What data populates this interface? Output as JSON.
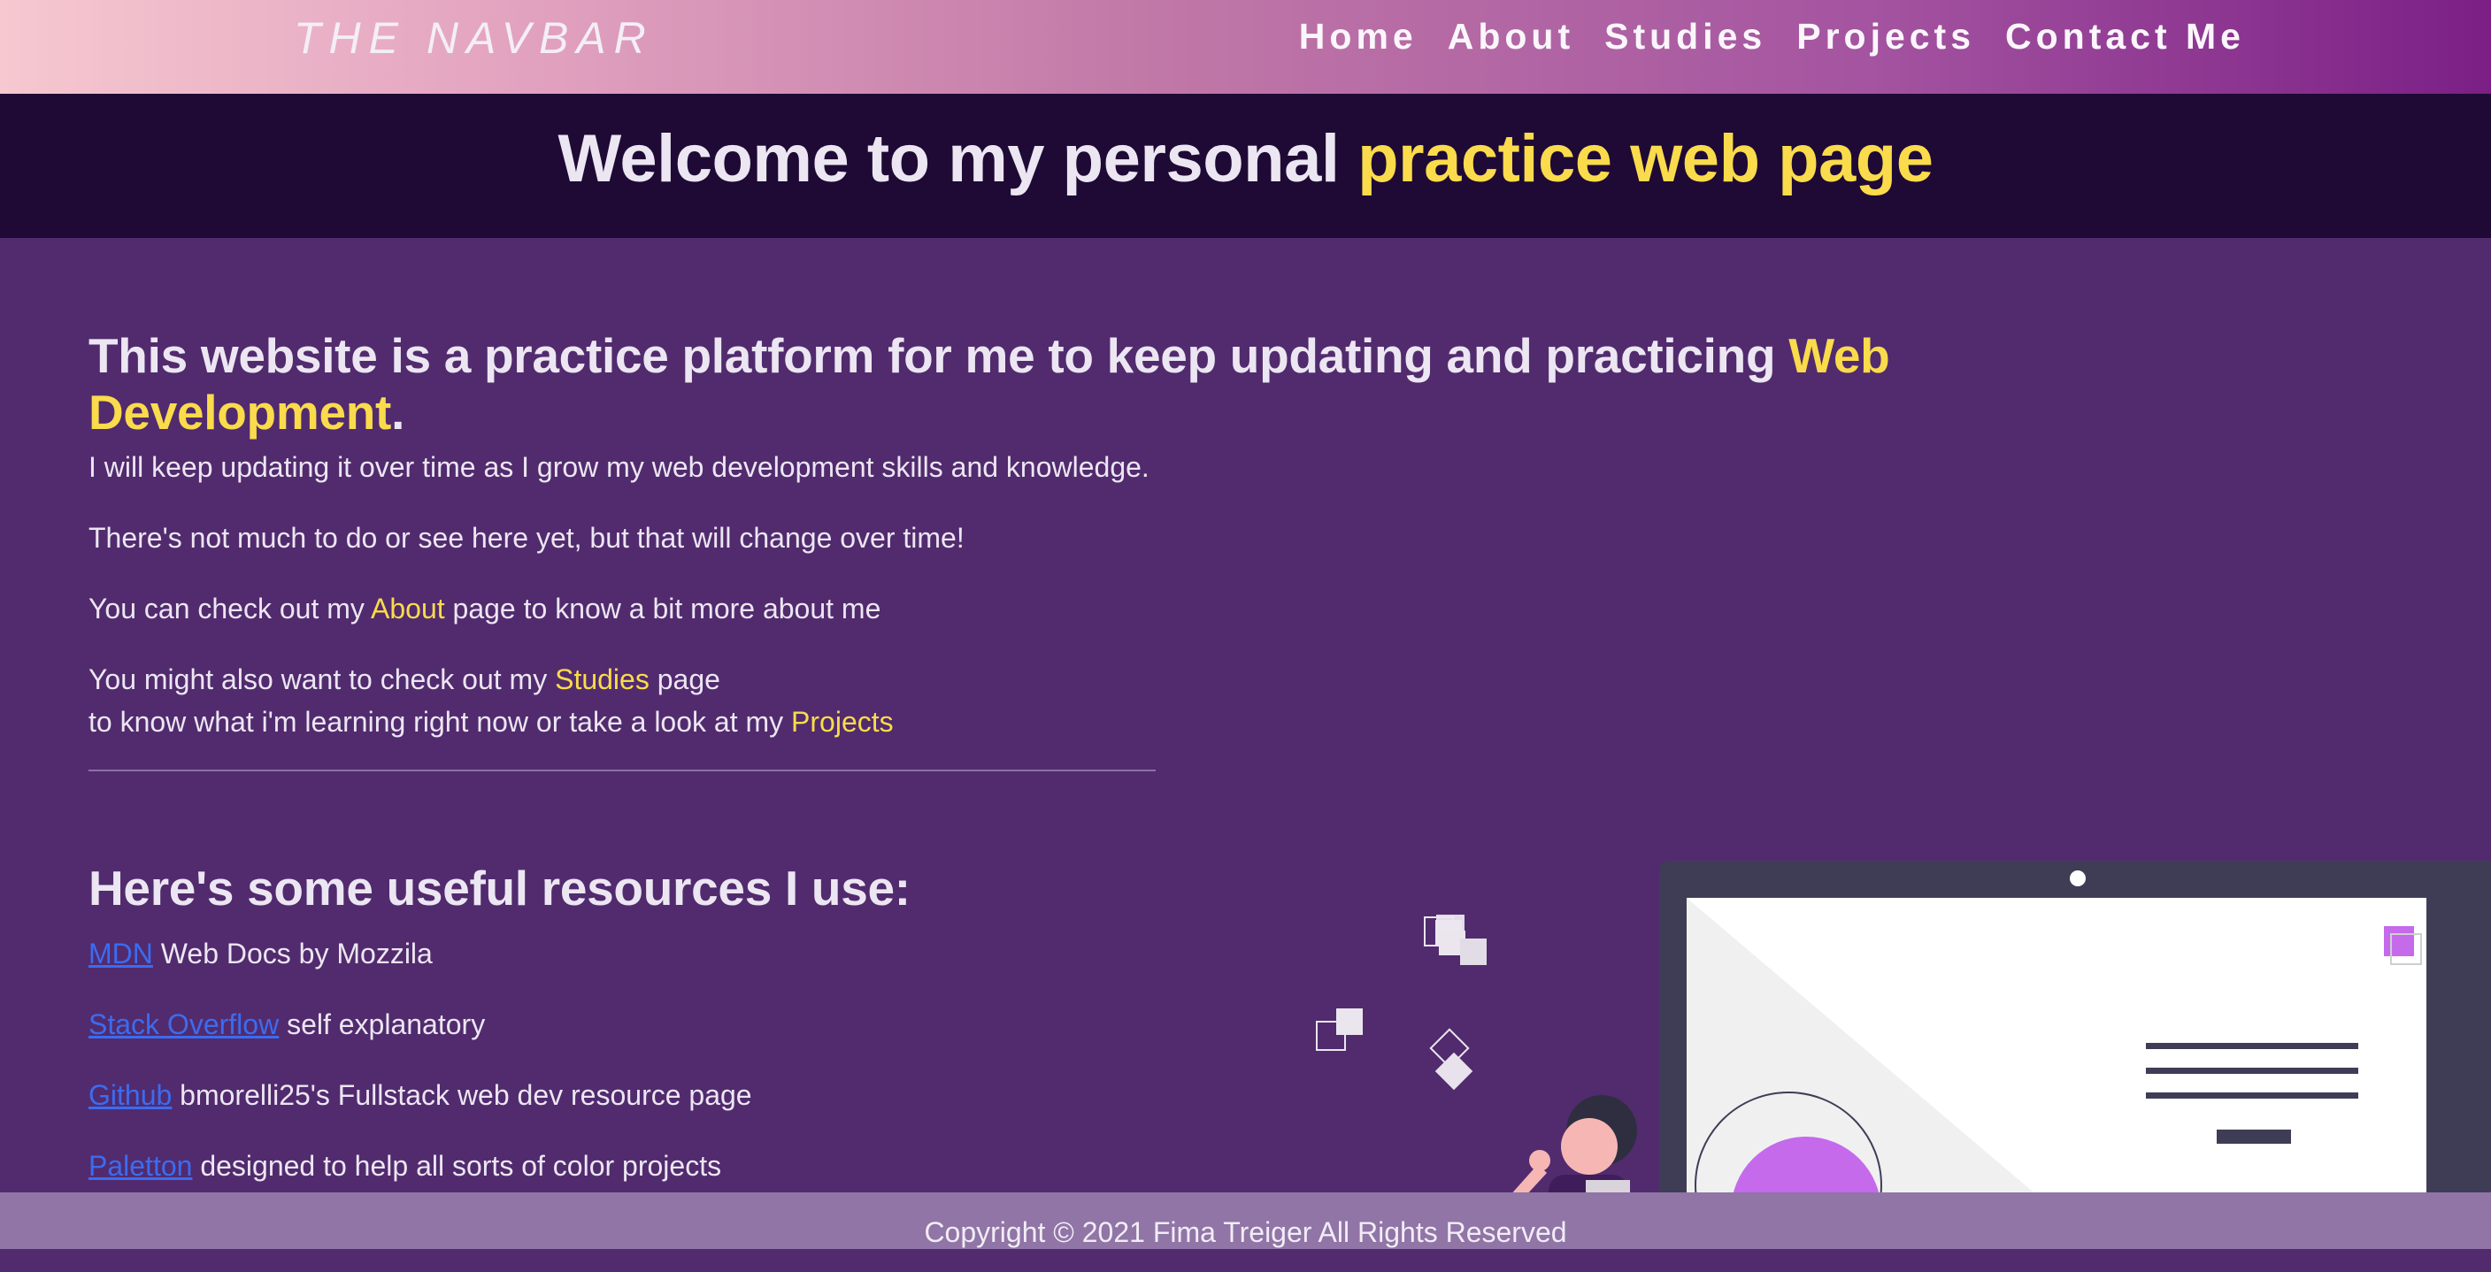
{
  "navbar": {
    "brand": "THE NAVBAR",
    "links": [
      "Home",
      "About",
      "Studies",
      "Projects",
      "Contact Me"
    ]
  },
  "hero": {
    "title_plain": "Welcome to my personal ",
    "title_accent": "practice web page"
  },
  "intro": {
    "heading_plain": "This website is a practice platform for me to keep updating and practicing ",
    "heading_accent": "Web Development",
    "heading_end": ".",
    "p1": "I will keep updating it over time as I grow my web development skills and knowledge.",
    "p2": "There's not much to do or see here yet, but that will change over time!",
    "p3_before": "You can check out my ",
    "p3_link": "About",
    "p3_after": " page to know a bit more about me",
    "p4_line1_before": "You might also want to check out my ",
    "p4_line1_link": "Studies",
    "p4_line1_after": " page",
    "p4_line2_before": "to know what i'm learning right now or take a look at my ",
    "p4_line2_link": "Projects"
  },
  "resources": {
    "heading": "Here's some useful resources I use:",
    "items": [
      {
        "link": "MDN",
        "text": " Web Docs by Mozzila"
      },
      {
        "link": "Stack Overflow",
        "text": " self explanatory"
      },
      {
        "link": "Github",
        "text": " bmorelli25's Fullstack web dev resource page"
      },
      {
        "link": "Paletton",
        "text": " designed to help all sorts of color projects"
      }
    ]
  },
  "footer": {
    "text": "Copyright © 2021 Fima Treiger All Rights Reserved"
  },
  "colors": {
    "accent": "#fadb4b",
    "link": "#3b6cf0",
    "background": "#512b6e",
    "hero_bg": "#1e0a35"
  }
}
